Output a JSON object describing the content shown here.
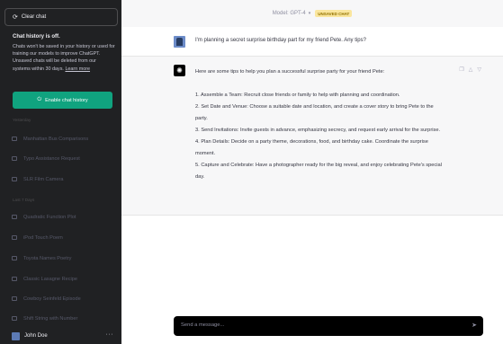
{
  "sidebar": {
    "clear_chat": "Clear chat",
    "notice": {
      "title": "Chat history is off.",
      "body": "Chats won't be saved in your history or used for training our models to improve ChatGPT. Unsaved chats will be deleted from our systems within 30 days.",
      "learn_more": "Learn more"
    },
    "enable_label": "Enable chat history",
    "sections": [
      {
        "label": "Yesterday",
        "items": [
          "Manhattan Bus Comparisons",
          "Typo Assistance Request",
          "SLR Film Camera"
        ]
      },
      {
        "label": "Last 7 Days",
        "items": [
          "Quadratic Function Plot",
          "iPod Touch Poem",
          "Toyota Names Poetry",
          "Classic Lasagne Recipe",
          "Cowboy Seinfeld Episode",
          "Shift String with Number"
        ]
      }
    ],
    "user_name": "John Doe",
    "more": "···"
  },
  "topbar": {
    "model": "Model: GPT-4",
    "badge": "UNSAVED CHAT"
  },
  "conversation": {
    "user_message": "I'm planning a secret surprise birthday part for my friend Pete. Any tips?",
    "assistant": {
      "intro": "Here are some tips to help you plan a successful surprise party for your friend Pete:",
      "tips": [
        "1. Assemble a Team: Recruit close friends or family to help with planning and coordination.",
        "2. Set Date and Venue: Choose a suitable date and location, and create a cover story to bring Pete to the party.",
        "3. Send Invitations: Invite guests in advance, emphasizing secrecy, and request early arrival for the surprise.",
        "4. Plan Details: Decide on a party theme, decorations, food, and birthday cake. Coordinate the surprise moment.",
        "5. Capture and Celebrate: Have a photographer ready for the big reveal, and enjoy celebrating Pete's special day."
      ]
    }
  },
  "composer": {
    "placeholder": "Send a message..."
  },
  "colors": {
    "sidebar_bg": "#202123",
    "accent": "#10a37f",
    "badge_bg": "#fae69e"
  }
}
